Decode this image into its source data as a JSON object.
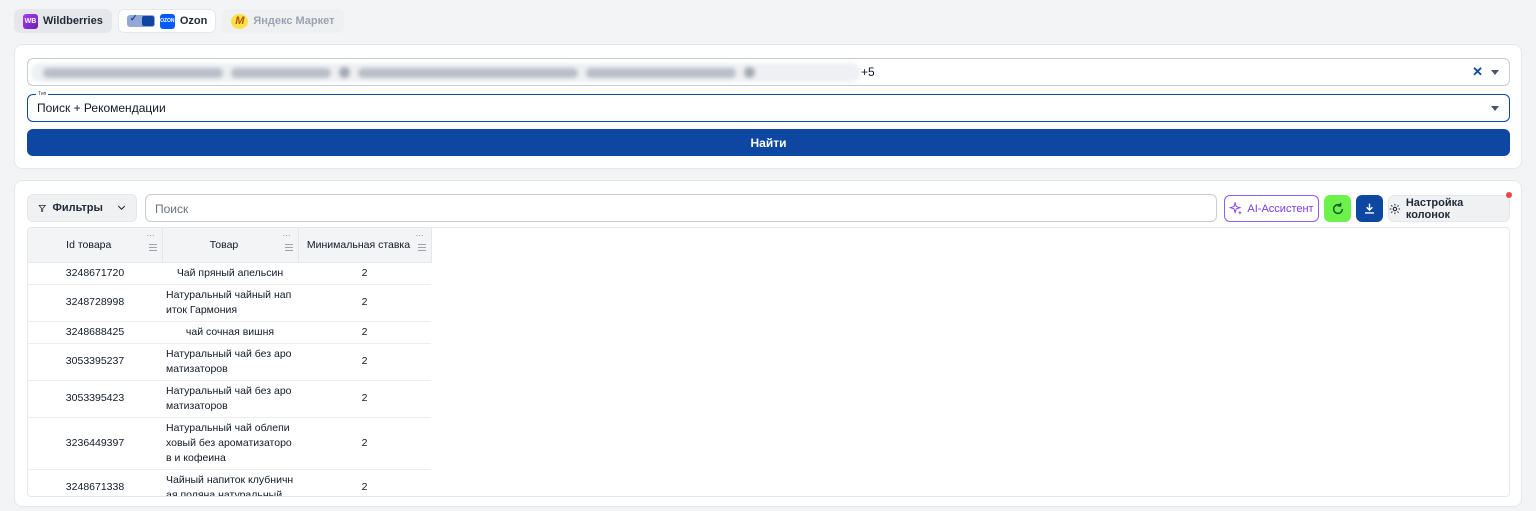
{
  "marketplaces": {
    "wildberries": {
      "label": "Wildberries",
      "logo": "WB"
    },
    "ozon": {
      "label": "Ozon",
      "logo": "OZON"
    },
    "yandex": {
      "label": "Яндекс Маркет",
      "logo": "M"
    }
  },
  "search_form": {
    "products_more": "+5",
    "type_legend": "Тип",
    "type_value": "Поиск + Рекомендации",
    "find_label": "Найти"
  },
  "toolbar": {
    "filters_label": "Фильтры",
    "search_placeholder": "Поиск",
    "ai_label": "AI-Ассистент",
    "columns_label": "Настройка колонок"
  },
  "table": {
    "headers": [
      "Id товара",
      "Товар",
      "Минимальная ставка"
    ],
    "rows": [
      {
        "id": "3248671720",
        "product": "Чай пряный апельсин",
        "bid": "2"
      },
      {
        "id": "3248728998",
        "product": "Натуральный чайный напиток Гармония",
        "bid": "2"
      },
      {
        "id": "3248688425",
        "product": "чай сочная вишня",
        "bid": "2"
      },
      {
        "id": "3053395237",
        "product": "Натуральный чай без ароматизаторов",
        "bid": "2"
      },
      {
        "id": "3053395423",
        "product": "Натуральный чай без ароматизаторов",
        "bid": "2"
      },
      {
        "id": "3236449397",
        "product": "Натуральный чай облепиховый без ароматизаторов и кофеина",
        "bid": "2"
      },
      {
        "id": "3248671338",
        "product": "Чайный напиток клубничная поляна натуральный",
        "bid": "2"
      }
    ]
  }
}
